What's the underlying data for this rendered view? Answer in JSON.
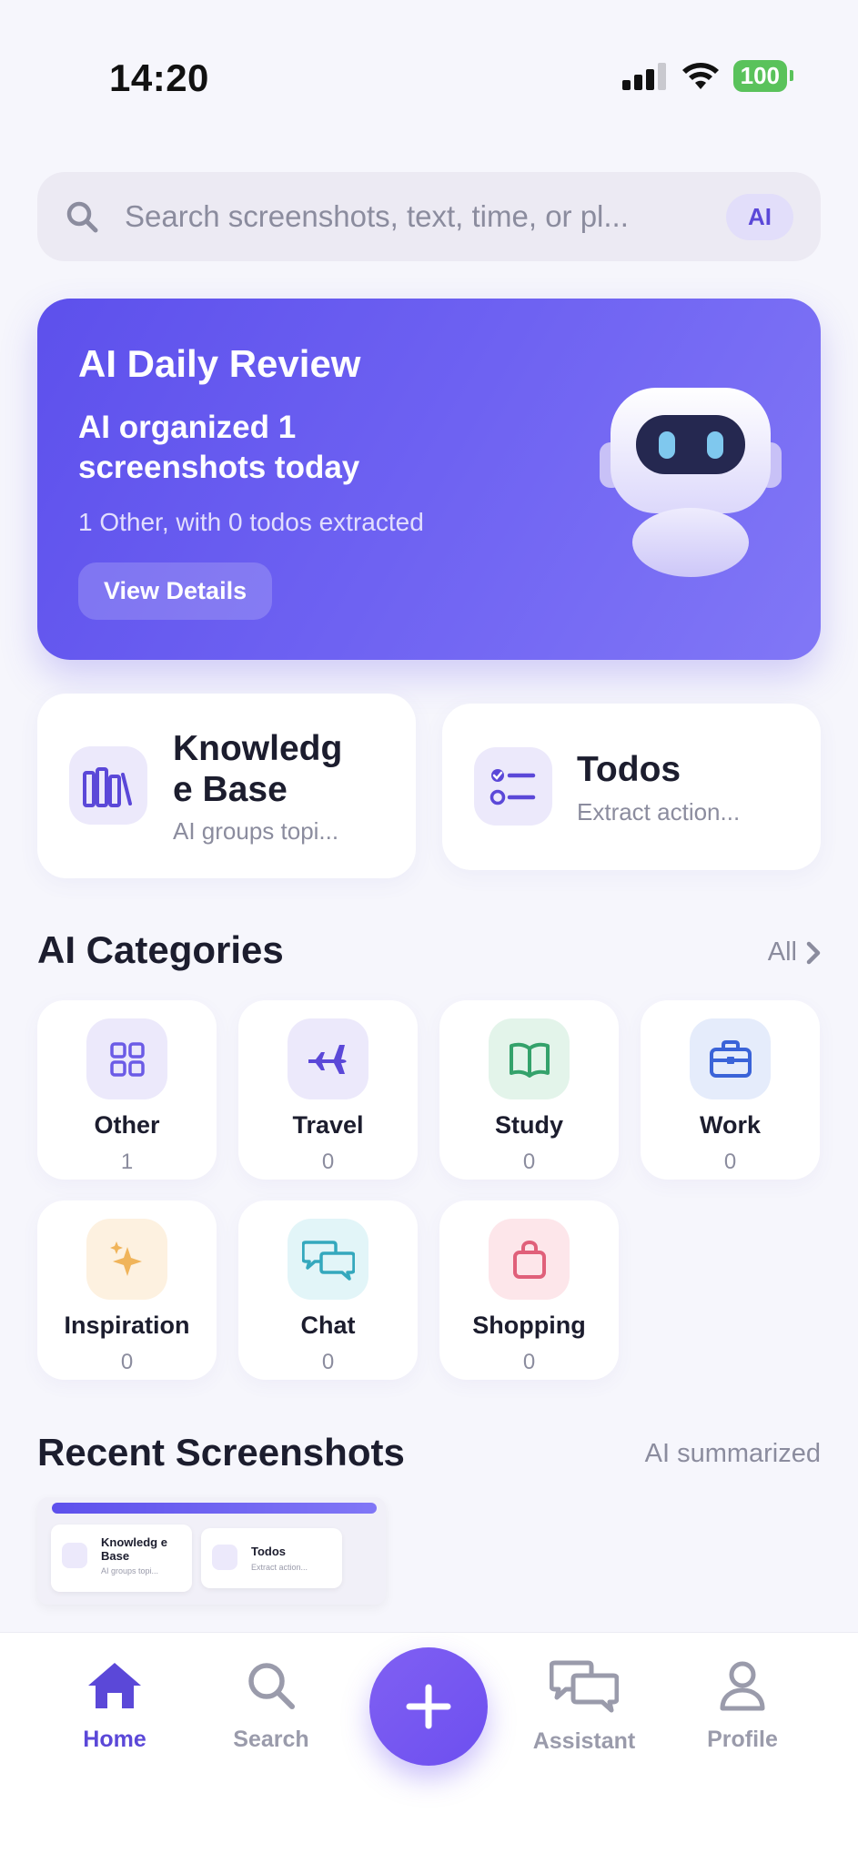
{
  "status_bar": {
    "time": "14:20",
    "battery": "100"
  },
  "search": {
    "placeholder": "Search screenshots, text, time, or pl...",
    "ai_label": "AI"
  },
  "review": {
    "title": "AI Daily Review",
    "headline": "AI organized 1 screenshots today",
    "subtitle": "1 Other, with 0 todos extracted",
    "button": "View Details"
  },
  "features": [
    {
      "title": "Knowledg e Base",
      "subtitle": "AI groups topi...",
      "icon": "books-icon"
    },
    {
      "title": "Todos",
      "subtitle": "Extract action...",
      "icon": "checklist-icon"
    }
  ],
  "categories_section": {
    "title": "AI Categories",
    "link": "All"
  },
  "categories": [
    {
      "name": "Other",
      "count": "1",
      "icon": "grid-icon",
      "color": "#6b5be6",
      "bg": "#ece9fb"
    },
    {
      "name": "Travel",
      "count": "0",
      "icon": "airplane-icon",
      "color": "#5b48d8",
      "bg": "#ece9fb"
    },
    {
      "name": "Study",
      "count": "0",
      "icon": "book-icon",
      "color": "#34a26b",
      "bg": "#e3f4ea"
    },
    {
      "name": "Work",
      "count": "0",
      "icon": "briefcase-icon",
      "color": "#3a63d8",
      "bg": "#e5ecfb"
    },
    {
      "name": "Inspiration",
      "count": "0",
      "icon": "sparkle-icon",
      "color": "#f0b45a",
      "bg": "#fdf1e0"
    },
    {
      "name": "Chat",
      "count": "0",
      "icon": "chat-icon",
      "color": "#34a8bd",
      "bg": "#e2f5f8"
    },
    {
      "name": "Shopping",
      "count": "0",
      "icon": "bag-icon",
      "color": "#e0607a",
      "bg": "#fde6ea"
    }
  ],
  "recent_section": {
    "title": "Recent Screenshots",
    "link": "AI summarized"
  },
  "recent_thumb": {
    "card1_title": "Knowledg e Base",
    "card1_sub": "AI groups topi...",
    "card2_title": "Todos",
    "card2_sub": "Extract action..."
  },
  "nav": [
    {
      "label": "Home",
      "icon": "home-icon",
      "active": true
    },
    {
      "label": "Search",
      "icon": "search-icon",
      "active": false
    },
    {
      "label": "Assistant",
      "icon": "chat-bubbles-icon",
      "active": false
    },
    {
      "label": "Profile",
      "icon": "person-icon",
      "active": false
    }
  ],
  "accent": "#5b48d8"
}
